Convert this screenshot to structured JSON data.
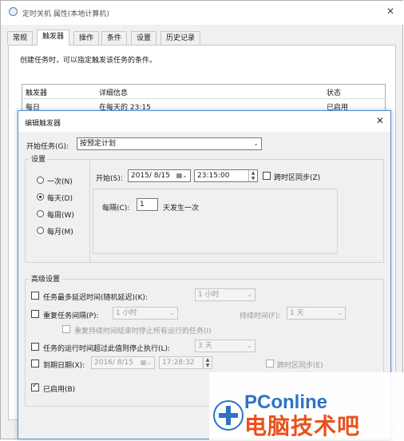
{
  "window": {
    "title": "定时关机 属性(本地计算机)",
    "tabs": [
      "常规",
      "触发器",
      "操作",
      "条件",
      "设置",
      "历史记录"
    ],
    "description": "创建任务时，可以指定触发该任务的条件。",
    "table": {
      "columns": [
        "触发器",
        "详细信息",
        "状态"
      ],
      "rows": [
        [
          "每日",
          "在每天的 23:15",
          "已启用"
        ]
      ]
    }
  },
  "dialog": {
    "title": "编辑触发器",
    "begin_label": "开始任务(G):",
    "begin_value": "按预定计划",
    "settings_label": "设置",
    "radios": [
      "一次(N)",
      "每天(D)",
      "每周(W)",
      "每月(M)"
    ],
    "start_label": "开始(S):",
    "start_date": "2015/ 8/15",
    "start_time": "23:15:00",
    "sync_label": "跨时区同步(Z)",
    "recur_label": "每隔(C):",
    "recur_value": "1",
    "recur_unit": "天发生一次",
    "advanced_label": "高级设置",
    "delay_label": "任务最多延迟时间(随机延迟)(K):",
    "delay_value": "1 小时",
    "repeat_label": "重复任务间隔(P):",
    "repeat_value": "1 小时",
    "duration_label": "持续时间(F):",
    "duration_value": "1 天",
    "stop_all_label": "重复持续时间结束时停止所有运行的任务(I)",
    "stop_longer_label": "任务的运行时间超过此值则停止执行(L):",
    "stop_longer_value": "3 天",
    "expire_label": "到期日期(X):",
    "expire_date": "2016/ 8/15",
    "expire_time": "17:28:32",
    "expire_sync_label": "跨时区同步(E)",
    "enabled_label": "已启用(B)"
  },
  "watermark": {
    "brand": "PConline",
    "slogan": "电脑技术吧"
  }
}
